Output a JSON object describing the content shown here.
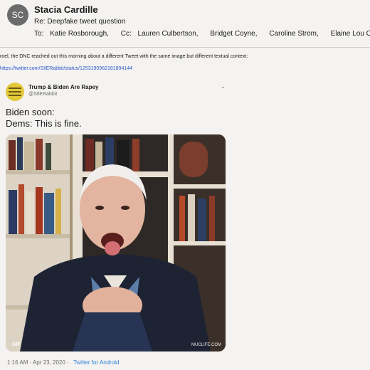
{
  "email": {
    "avatar_initials": "SC",
    "sender": "Stacia Cardille",
    "subject": "Re: Deepfake tweet question",
    "to_label": "To:",
    "to": [
      "Katie Rosborough,"
    ],
    "cc_label": "Cc:",
    "cc": [
      "Lauren Culbertson,",
      "Bridget Coyne,",
      "Caroline Strom,",
      "Elaine Lou Ong"
    ],
    "body_text": "roel, the DNC reached out this morning about a different Tweet with the same image but different textual context:",
    "link_text": "https://twitter.com/SIlERabbit/status/1253190962181894144"
  },
  "tweet": {
    "display_name": "Trump & Biden Are Rapey",
    "handle": "@SIlERabbit",
    "text_line_1": "Biden soon:",
    "text_line_2": "Dems: This is fine.",
    "media_badge": "GIF",
    "media_watermark": "MUCLIFE.COM",
    "timestamp": "1:16 AM · Apr 23, 2020 ·",
    "source": "Twitter for Android",
    "icons": {
      "chevron": "chevron-down-icon",
      "avatar": "profile-avatar"
    }
  },
  "colors": {
    "link": "#2b57c9",
    "source_link": "#2b7fd6",
    "avatar_bg": "#6b6b6b",
    "page_bg": "#f4f3f1"
  }
}
